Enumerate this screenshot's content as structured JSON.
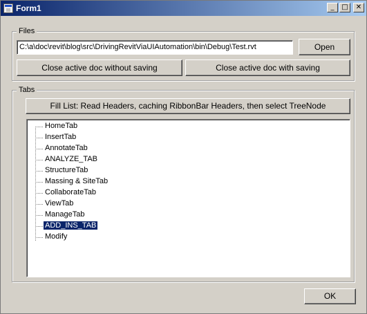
{
  "window": {
    "title": "Form1",
    "minimize_glyph": "_",
    "maximize_glyph": "□",
    "close_glyph": "✕"
  },
  "files": {
    "group_label": "Files",
    "path_value": "C:\\a\\doc\\revit\\blog\\src\\DrivingRevitViaUIAutomation\\bin\\Debug\\Test.rvt",
    "open_label": "Open",
    "close_without_saving_label": "Close active doc without saving",
    "close_with_saving_label": "Close active doc with saving"
  },
  "tabs": {
    "group_label": "Tabs",
    "fill_list_label": "Fill List: Read Headers, caching RibbonBar Headers, then select TreeNode",
    "items": [
      {
        "label": "HomeTab",
        "selected": false
      },
      {
        "label": "InsertTab",
        "selected": false
      },
      {
        "label": "AnnotateTab",
        "selected": false
      },
      {
        "label": "ANALYZE_TAB",
        "selected": false
      },
      {
        "label": "StructureTab",
        "selected": false
      },
      {
        "label": "Massing & SiteTab",
        "selected": false
      },
      {
        "label": "CollaborateTab",
        "selected": false
      },
      {
        "label": "ViewTab",
        "selected": false
      },
      {
        "label": "ManageTab",
        "selected": false
      },
      {
        "label": "ADD_INS_TAB",
        "selected": true
      },
      {
        "label": "Modify",
        "selected": false
      }
    ]
  },
  "footer": {
    "ok_label": "OK"
  },
  "colors": {
    "face": "#d4d0c8",
    "title_start": "#0a246a",
    "title_end": "#a6caf0",
    "selection": "#0a246a"
  }
}
